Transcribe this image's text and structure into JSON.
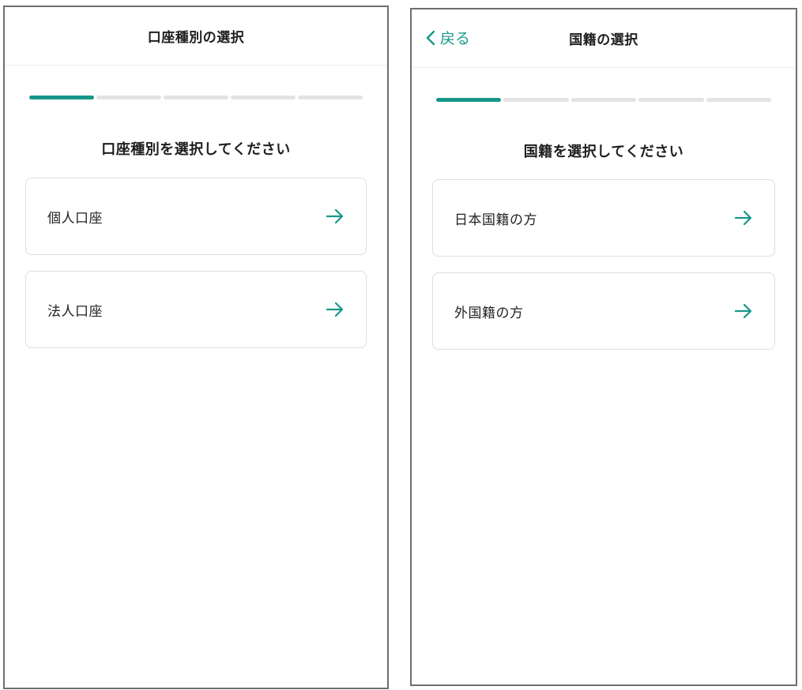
{
  "accent_color": "#17978a",
  "screen1": {
    "header": {
      "title": "口座種別の選択"
    },
    "progress": {
      "total_steps": 5,
      "current_step": 1
    },
    "prompt": "口座種別を選択してください",
    "options": [
      {
        "label": "個人口座",
        "icon": "arrow-right-icon"
      },
      {
        "label": "法人口座",
        "icon": "arrow-right-icon"
      }
    ]
  },
  "screen2": {
    "header": {
      "back_label": "戻る",
      "back_icon": "chevron-left-icon",
      "title": "国籍の選択"
    },
    "progress": {
      "total_steps": 5,
      "current_step": 1
    },
    "prompt": "国籍を選択してください",
    "options": [
      {
        "label": "日本国籍の方",
        "icon": "arrow-right-icon"
      },
      {
        "label": "外国籍の方",
        "icon": "arrow-right-icon"
      }
    ]
  }
}
